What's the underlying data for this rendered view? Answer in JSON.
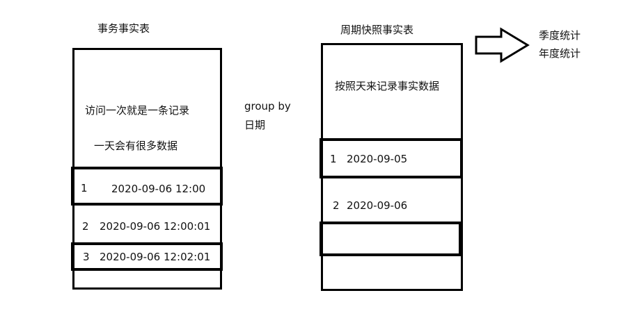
{
  "left_table": {
    "title": "事务事实表",
    "desc_line1": "访问一次就是一条记录",
    "desc_line2": "一天会有很多数据",
    "rows": [
      {
        "num": "1",
        "value": "2020-09-06 12:00"
      },
      {
        "num": "2",
        "value": "2020-09-06 12:00:01"
      },
      {
        "num": "3",
        "value": "2020-09-06 12:02:01"
      }
    ]
  },
  "middle": {
    "group_line1": "group by",
    "group_line2": "日期"
  },
  "right_table": {
    "title": "周期快照事实表",
    "desc": "按照天来记录事实数据",
    "rows": [
      {
        "num": "1",
        "value": "2020-09-05"
      },
      {
        "num": "2",
        "value": "2020-09-06"
      }
    ]
  },
  "arrow": {
    "icon": "right-arrow-icon",
    "line1": "季度统计",
    "line2": "年度统计"
  }
}
